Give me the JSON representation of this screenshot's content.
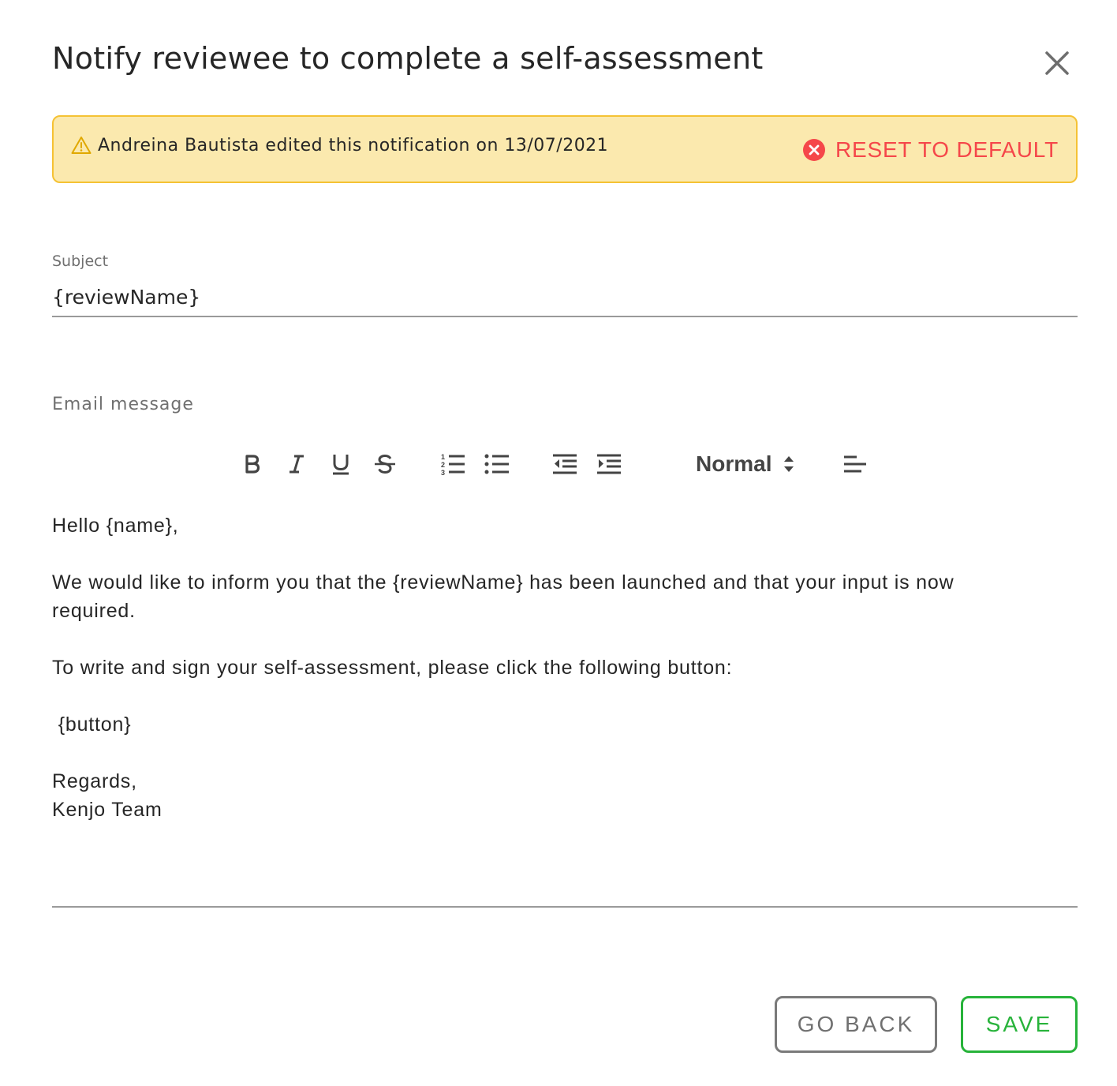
{
  "dialog": {
    "title": "Notify reviewee to complete a self-assessment"
  },
  "banner": {
    "message": "Andreina Bautista edited this notification on 13/07/2021",
    "reset_label": "RESET TO DEFAULT",
    "icon": "warning-icon",
    "reset_icon": "error-circle-icon",
    "colors": {
      "background": "#fbe9ae",
      "border": "#f5c234",
      "reset": "#f5474a"
    }
  },
  "subject": {
    "label": "Subject",
    "value": "{reviewName}"
  },
  "email": {
    "label": "Email message",
    "toolbar": {
      "bold": "bold-icon",
      "italic": "italic-icon",
      "underline": "underline-icon",
      "strike": "strikethrough-icon",
      "ordered_list": "ordered-list-icon",
      "bullet_list": "bullet-list-icon",
      "outdent": "outdent-icon",
      "indent": "indent-icon",
      "size_value": "Normal",
      "align": "align-left-icon"
    },
    "lines": [
      "Hello {name},",
      "We would like to inform you that the {reviewName} has been launched and that your input is now",
      "required.",
      "To write and sign your self-assessment, please click the following button:",
      " {button}",
      "Regards,",
      "Kenjo Team"
    ]
  },
  "actions": {
    "back_label": "GO BACK",
    "save_label": "SAVE",
    "colors": {
      "save": "#27b33a",
      "back": "#7a7a7a"
    }
  }
}
